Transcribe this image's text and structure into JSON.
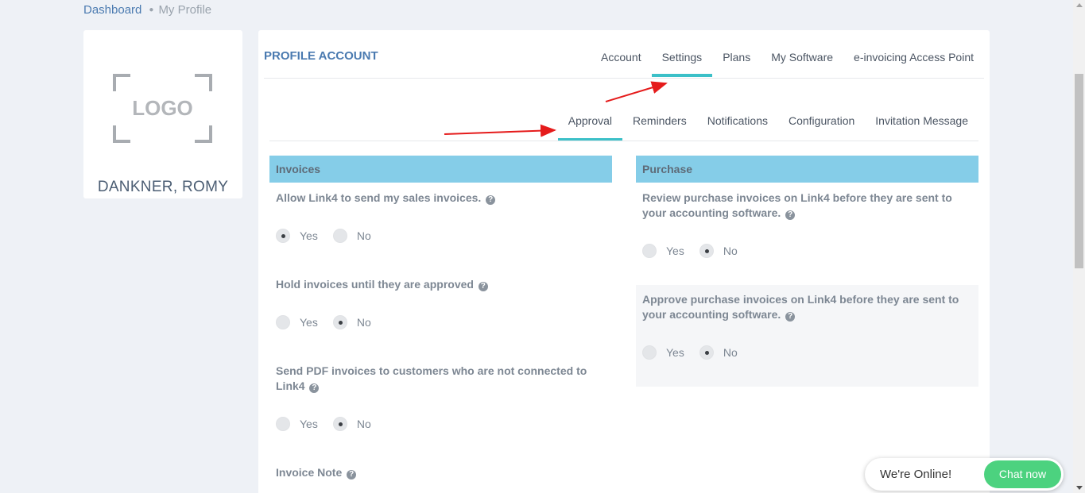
{
  "breadcrumb": {
    "home": "Dashboard",
    "separator": "●",
    "current": "My Profile"
  },
  "profile": {
    "logo_text": "LOGO",
    "name": "DANKNER, ROMY"
  },
  "main": {
    "title": "PROFILE ACCOUNT",
    "top_tabs": [
      {
        "label": "Account",
        "active": false
      },
      {
        "label": "Settings",
        "active": true
      },
      {
        "label": "Plans",
        "active": false
      },
      {
        "label": "My Software",
        "active": false
      },
      {
        "label": "e-invoicing Access Point",
        "active": false
      }
    ],
    "sub_tabs": [
      {
        "label": "Approval",
        "active": true
      },
      {
        "label": "Reminders",
        "active": false
      },
      {
        "label": "Notifications",
        "active": false
      },
      {
        "label": "Configuration",
        "active": false
      },
      {
        "label": "Invitation Message",
        "active": false
      }
    ]
  },
  "invoices": {
    "heading": "Invoices",
    "questions": [
      {
        "text": "Allow Link4 to send my sales invoices.",
        "selected": "Yes"
      },
      {
        "text": "Hold invoices until they are approved",
        "selected": "No"
      },
      {
        "text": "Send PDF invoices to customers who are not connected to Link4",
        "selected": "No"
      }
    ],
    "note_label": "Invoice Note"
  },
  "purchase": {
    "heading": "Purchase",
    "questions": [
      {
        "text": "Review purchase invoices on Link4 before they are sent to your accounting software.",
        "selected": "No"
      },
      {
        "text": "Approve purchase invoices on Link4 before they are sent to your accounting software.",
        "selected": "No"
      }
    ]
  },
  "options": {
    "yes": "Yes",
    "no": "No"
  },
  "help_icon_glyph": "?",
  "chat": {
    "status_text": "We're Online!",
    "button_label": "Chat now"
  },
  "colors": {
    "accent": "#3cc0c8",
    "section_header": "#85cde8",
    "link": "#4a7ab0",
    "chat_button": "#4cd27f",
    "annotation_arrow": "#e51b1b"
  }
}
